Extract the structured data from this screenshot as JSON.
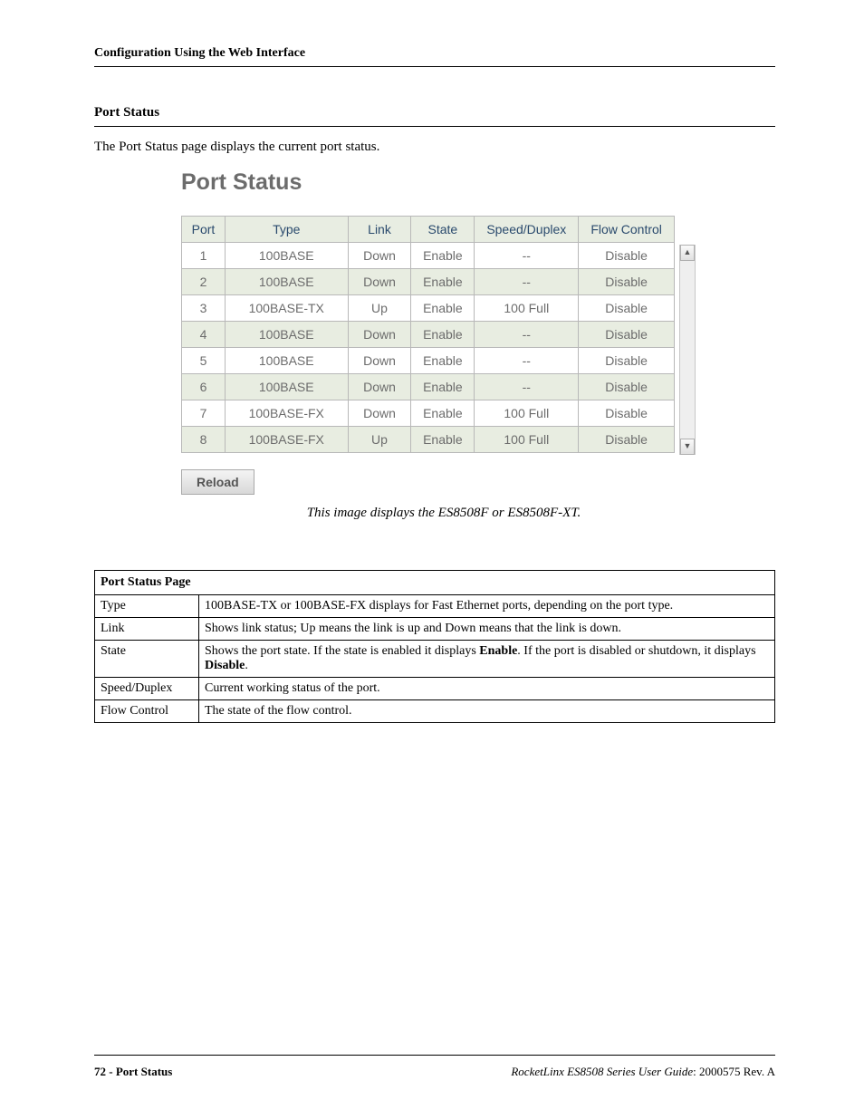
{
  "header": {
    "title": "Configuration Using the Web Interface"
  },
  "section": {
    "title": "Port Status",
    "intro": "The Port Status page displays the current port status."
  },
  "screenshot": {
    "heading": "Port Status",
    "columns": {
      "port": "Port",
      "type": "Type",
      "link": "Link",
      "state": "State",
      "speed": "Speed/Duplex",
      "flow": "Flow Control"
    },
    "rows": [
      {
        "port": "1",
        "type": "100BASE",
        "link": "Down",
        "state": "Enable",
        "speed": "--",
        "flow": "Disable"
      },
      {
        "port": "2",
        "type": "100BASE",
        "link": "Down",
        "state": "Enable",
        "speed": "--",
        "flow": "Disable"
      },
      {
        "port": "3",
        "type": "100BASE-TX",
        "link": "Up",
        "state": "Enable",
        "speed": "100 Full",
        "flow": "Disable"
      },
      {
        "port": "4",
        "type": "100BASE",
        "link": "Down",
        "state": "Enable",
        "speed": "--",
        "flow": "Disable"
      },
      {
        "port": "5",
        "type": "100BASE",
        "link": "Down",
        "state": "Enable",
        "speed": "--",
        "flow": "Disable"
      },
      {
        "port": "6",
        "type": "100BASE",
        "link": "Down",
        "state": "Enable",
        "speed": "--",
        "flow": "Disable"
      },
      {
        "port": "7",
        "type": "100BASE-FX",
        "link": "Down",
        "state": "Enable",
        "speed": "100 Full",
        "flow": "Disable"
      },
      {
        "port": "8",
        "type": "100BASE-FX",
        "link": "Up",
        "state": "Enable",
        "speed": "100 Full",
        "flow": "Disable"
      }
    ],
    "reload_label": "Reload",
    "caption": "This image displays the ES8508F or ES8508F-XT."
  },
  "descTable": {
    "header": "Port Status Page",
    "rows": [
      {
        "label": "Type",
        "desc_html": "100BASE-TX or 100BASE-FX displays for Fast Ethernet ports, depending on the port type."
      },
      {
        "label": "Link",
        "desc_html": "Shows link status; Up means the link is up and Down means that the link is down."
      },
      {
        "label": "State",
        "desc_html": "Shows the port state. If the state is enabled it displays <b>Enable</b>. If the port is disabled or shutdown, it displays <b>Disable</b>."
      },
      {
        "label": "Speed/Duplex",
        "desc_html": "Current working status of the port."
      },
      {
        "label": "Flow Control",
        "desc_html": "The state of the flow control."
      }
    ]
  },
  "footer": {
    "page": "72",
    "section": "Port Status",
    "product": "RocketLinx ES8508 Series  User Guide",
    "docnum": "2000575 Rev. A"
  }
}
